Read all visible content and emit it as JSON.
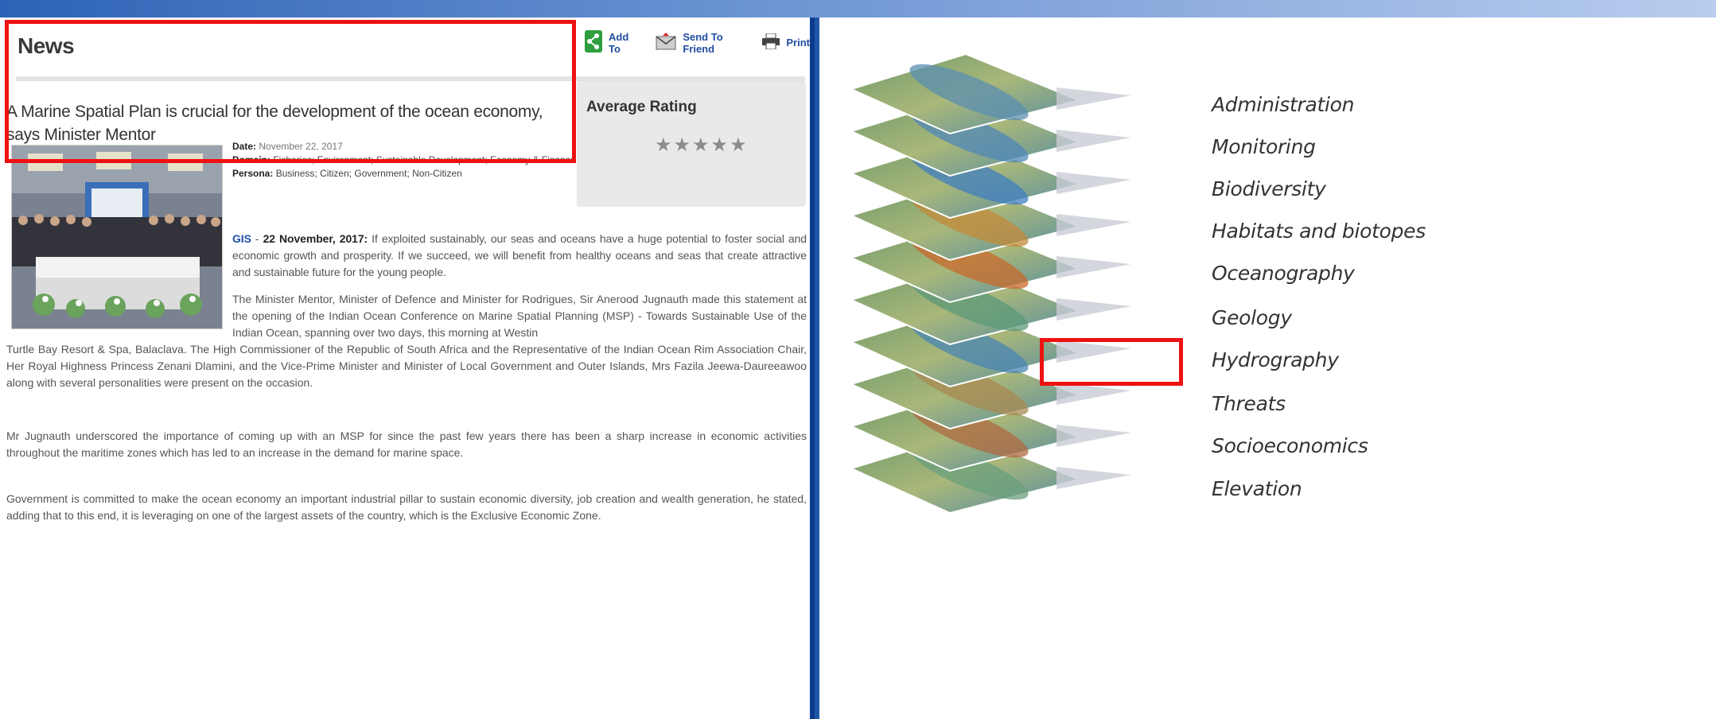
{
  "news": {
    "heading": "News",
    "toolbar": {
      "add_to": "Add To",
      "send_to_friend": "Send To Friend",
      "print": "Print"
    },
    "headline": "A Marine Spatial Plan is crucial for the development of the ocean economy, says Minister Mentor",
    "rating": {
      "title": "Average Rating",
      "stars": "★★★★★",
      "value": 0,
      "max": 5
    },
    "meta": {
      "date_label": "Date:",
      "date_value": "November 22, 2017",
      "domain_label": "Domain:",
      "domain_value": "Fisheries; Environment; Sustainable Development; Economy & Finance",
      "persona_label": "Persona:",
      "persona_value": "Business; Citizen; Government; Non-Citizen"
    },
    "body": {
      "source": "GIS",
      "separator": " - ",
      "dateline": "22 November, 2017:",
      "p1": " If exploited sustainably, our seas and oceans have a huge potential to foster social and economic growth and prosperity. If we succeed, we will benefit from healthy oceans and seas that create attractive and sustainable future for the young people.",
      "p2a": "The Minister Mentor, Minister of Defence and Minister for Rodrigues, Sir Anerood Jugnauth made this statement at the opening of the Indian Ocean Conference on Marine Spatial Planning (MSP) - Towards Sustainable Use of the Indian Ocean, spanning over two days, this morning at Westin",
      "p2b": "Turtle Bay Resort & Spa, Balaclava. The High Commissioner of the Republic of South Africa and the Representative of the Indian Ocean Rim Association Chair, Her Royal Highness Princess Zenani Dlamini, and the Vice-Prime Minister and Minister of Local Government and Outer Islands, Mrs Fazila Jeewa-Daureeawoo along with several personalities were present on the occasion.",
      "p3": "Mr Jugnauth  underscored the importance of coming up with an MSP for since the past few years there has been a sharp increase in economic activities throughout the maritime zones which has led to an increase in the demand for marine space.",
      "p4": "Government is committed to make the ocean economy an important industrial pillar to sustain economic diversity, job creation and wealth generation, he stated, adding that to this end, it is leveraging on one of the largest assets of the country, which is the Exclusive Economic Zone."
    }
  },
  "layers": {
    "labels": [
      "Administration",
      "Monitoring",
      "Biodiversity",
      "Habitats and biotopes",
      "Oceanography",
      "Geology",
      "Hydrography",
      "Threats",
      "Socioeconomics",
      "Elevation"
    ],
    "highlighted": "Hydrography"
  },
  "colors": {
    "highlight_border": "#ee1111",
    "frame_blue": "#0c3b8e",
    "link_blue": "#1c4fa6"
  }
}
